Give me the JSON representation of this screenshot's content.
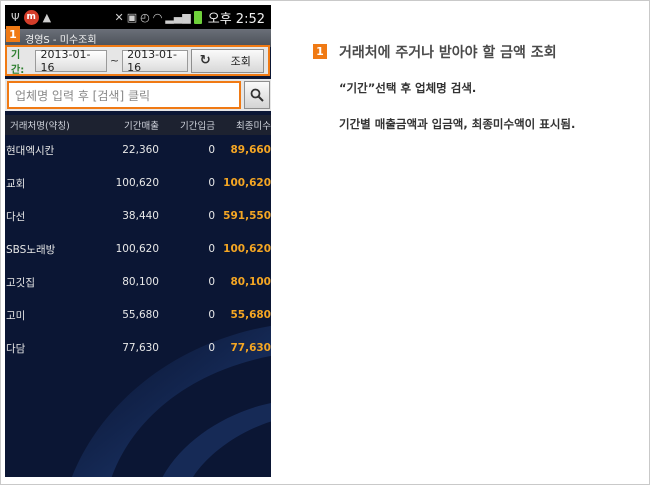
{
  "status_bar": {
    "m_label": "m",
    "time": "오후 2:52"
  },
  "app": {
    "title": "경영S - 미수조회",
    "badge_number": "1"
  },
  "filter": {
    "period_label": "기간:",
    "start_date": "2013-01-16",
    "separator": "~",
    "end_date": "2013-01-16",
    "query_button": "조회"
  },
  "search": {
    "placeholder": "업체명 입력 후 [검색] 클릭"
  },
  "table": {
    "headers": [
      "거래처명(약칭)",
      "기간매출",
      "기간입금",
      "최종미수"
    ],
    "rows": [
      {
        "name": "현대엑시칸",
        "sales": "22,360",
        "deposit": "0",
        "outstanding": "89,660"
      },
      {
        "name": "교회",
        "sales": "100,620",
        "deposit": "0",
        "outstanding": "100,620"
      },
      {
        "name": "다선",
        "sales": "38,440",
        "deposit": "0",
        "outstanding": "591,550"
      },
      {
        "name": "SBS노래방",
        "sales": "100,620",
        "deposit": "0",
        "outstanding": "100,620"
      },
      {
        "name": "고깃집",
        "sales": "80,100",
        "deposit": "0",
        "outstanding": "80,100"
      },
      {
        "name": "고미",
        "sales": "55,680",
        "deposit": "0",
        "outstanding": "55,680"
      },
      {
        "name": "다담",
        "sales": "77,630",
        "deposit": "0",
        "outstanding": "77,630"
      }
    ]
  },
  "description": {
    "badge_number": "1",
    "title": "거래처에 주거나 받아야 할 금액 조회",
    "line1": "“기간”선택 후 업체명 검색.",
    "line2": "기간별 매출금액과 입금액, 최종미수액이 표시됨."
  },
  "colors": {
    "accent_orange": "#f07a14",
    "amount_orange": "#f5a623",
    "screen_bg": "#0b1634",
    "period_label_green": "#2d7f2f"
  }
}
